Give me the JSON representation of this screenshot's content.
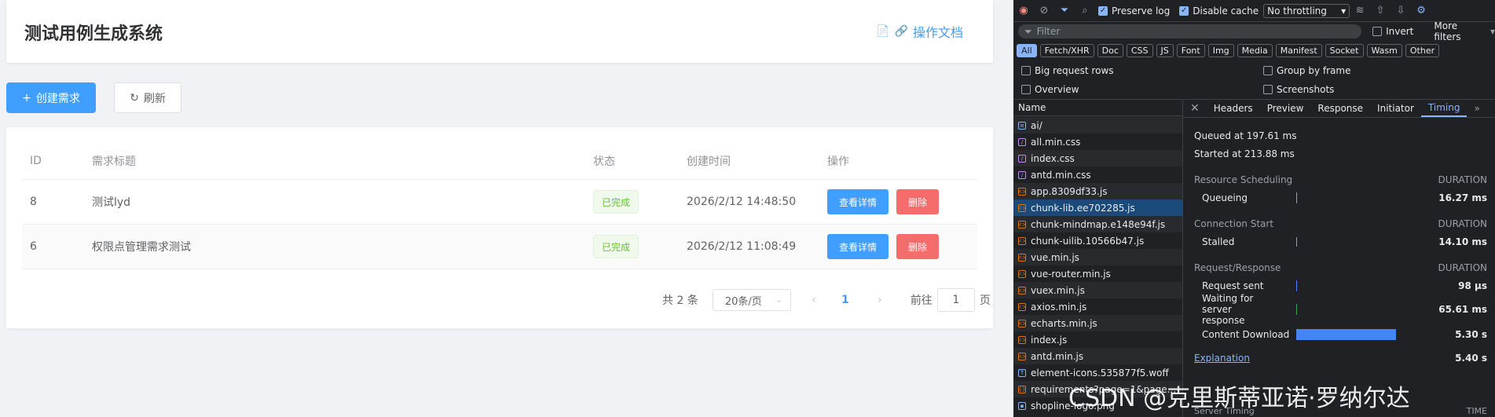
{
  "app": {
    "title": "测试用例生成系统",
    "doc_link": "操作文档",
    "create_btn": "创建需求",
    "refresh_btn": "刷新",
    "table": {
      "headers": [
        "ID",
        "需求标题",
        "状态",
        "创建时间",
        "操作"
      ],
      "rows": [
        {
          "id": "8",
          "title": "测试lyd",
          "status": "已完成",
          "time": "2026/2/12 14:48:50",
          "view": "查看详情",
          "delete": "删除"
        },
        {
          "id": "6",
          "title": "权限点管理需求测试",
          "status": "已完成",
          "time": "2026/2/12 11:08:49",
          "view": "查看详情",
          "delete": "删除"
        }
      ]
    },
    "pager": {
      "total": "共 2 条",
      "size": "20条/页",
      "current": "1",
      "goto": "前往",
      "goto_value": "1",
      "page_unit": "页"
    },
    "colors": {
      "primary": "#409eff",
      "danger": "#f56c6c",
      "success": "#67c23a"
    }
  },
  "devtools": {
    "preserve_log": "Preserve log",
    "disable_cache": "Disable cache",
    "throttling": "No throttling",
    "filter_placeholder": "Filter",
    "invert": "Invert",
    "more_filters": "More filters",
    "types": [
      "All",
      "Fetch/XHR",
      "Doc",
      "CSS",
      "JS",
      "Font",
      "Img",
      "Media",
      "Manifest",
      "Socket",
      "Wasm",
      "Other"
    ],
    "opt_big_rows": "Big request rows",
    "opt_group": "Group by frame",
    "opt_overview": "Overview",
    "opt_screenshots": "Screenshots",
    "name_header": "Name",
    "files": [
      "ai/",
      "all.min.css",
      "index.css",
      "antd.min.css",
      "app.8309df33.js",
      "chunk-lib.ee702285.js",
      "chunk-mindmap.e148e94f.js",
      "chunk-uilib.10566b47.js",
      "vue.min.js",
      "vue-router.min.js",
      "vuex.min.js",
      "axios.min.js",
      "echarts.min.js",
      "index.js",
      "antd.min.js",
      "element-icons.535877f5.woff",
      "requirements?page=1&page...",
      "shopline-logo.png"
    ],
    "tabs": [
      "Headers",
      "Preview",
      "Response",
      "Initiator",
      "Timing"
    ],
    "timing": {
      "queued": "Queued at 197.61 ms",
      "started": "Started at 213.88 ms",
      "rs_title": "Resource Scheduling",
      "duration": "DURATION",
      "queueing_label": "Queueing",
      "queueing_val": "16.27 ms",
      "cs_title": "Connection Start",
      "stalled_label": "Stalled",
      "stalled_val": "14.10 ms",
      "rr_title": "Request/Response",
      "sent_label": "Request sent",
      "sent_val": "98 µs",
      "wait_label": "Waiting for server response",
      "wait_val": "65.61 ms",
      "download_label": "Content Download",
      "download_val": "5.30 s",
      "explanation": "Explanation",
      "total_val": "5.40 s",
      "server_timing": "Server Timing",
      "time_label": "TIME"
    }
  },
  "watermark": "CSDN @克里斯蒂亚诺·罗纳尔达"
}
